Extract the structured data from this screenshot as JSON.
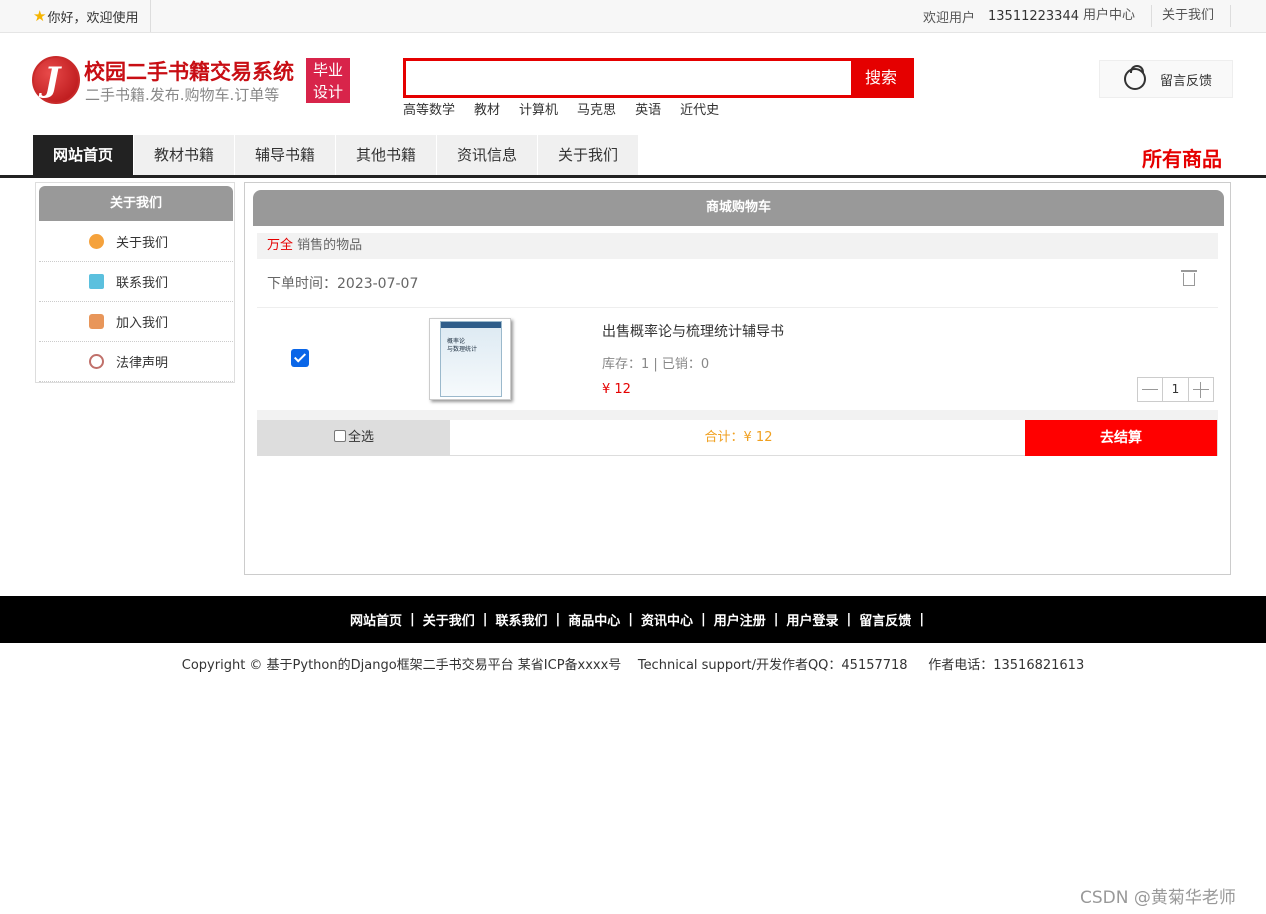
{
  "topbar": {
    "greeting": "你好，欢迎使用",
    "welcome": "欢迎用户",
    "phone": "13511223344",
    "user_center": "用户中心",
    "about": "关于我们"
  },
  "header": {
    "site_title": "校园二手书籍交易系统",
    "site_sub": "二手书籍.发布.购物车.订单等",
    "badge_line1": "毕业",
    "badge_line2": "设计",
    "search_placeholder": "",
    "search_button": "搜索",
    "hot_keywords": [
      "高等数学",
      "教材",
      "计算机",
      "马克思",
      "英语",
      "近代史"
    ],
    "feedback": "留言反馈"
  },
  "nav": {
    "items": [
      "网站首页",
      "教材书籍",
      "辅导书籍",
      "其他书籍",
      "资讯信息",
      "关于我们"
    ],
    "active_index": 0,
    "all_goods": "所有商品"
  },
  "sidebar": {
    "title": "关于我们",
    "items": [
      {
        "label": "关于我们",
        "icon": "about-icon"
      },
      {
        "label": "联系我们",
        "icon": "contact-icon"
      },
      {
        "label": "加入我们",
        "icon": "join-icon"
      },
      {
        "label": "法律声明",
        "icon": "law-icon"
      }
    ]
  },
  "cart": {
    "title": "商城购物车",
    "seller_name": "万全",
    "seller_suffix": " 销售的物品",
    "order_time_label": "下单时间：",
    "order_time": "2023-07-07",
    "item": {
      "checked": true,
      "name": "出售概率论与梳理统计辅导书",
      "stock_text": "库存：1 | 已销：0",
      "price": "¥ 12",
      "quantity": "1",
      "cover_title": "概率论\n与数理统计"
    },
    "select_all": "全选",
    "total": "合计：¥ 12",
    "checkout": "去结算"
  },
  "footer": {
    "links": [
      "网站首页",
      "关于我们",
      "联系我们",
      "商品中心",
      "资讯中心",
      "用户注册",
      "用户登录",
      "留言反馈"
    ],
    "copyright": "Copyright © 基于Python的Django框架二手书交易平台 某省ICP备xxxx号    Technical support/开发作者QQ：45157718     作者电话：13516821613"
  },
  "watermark": "CSDN @黄菊华老师",
  "colors": {
    "brand_red": "#e50000",
    "nav_active": "#222222",
    "panel_header": "#999999",
    "total_orange": "#f0a020"
  }
}
